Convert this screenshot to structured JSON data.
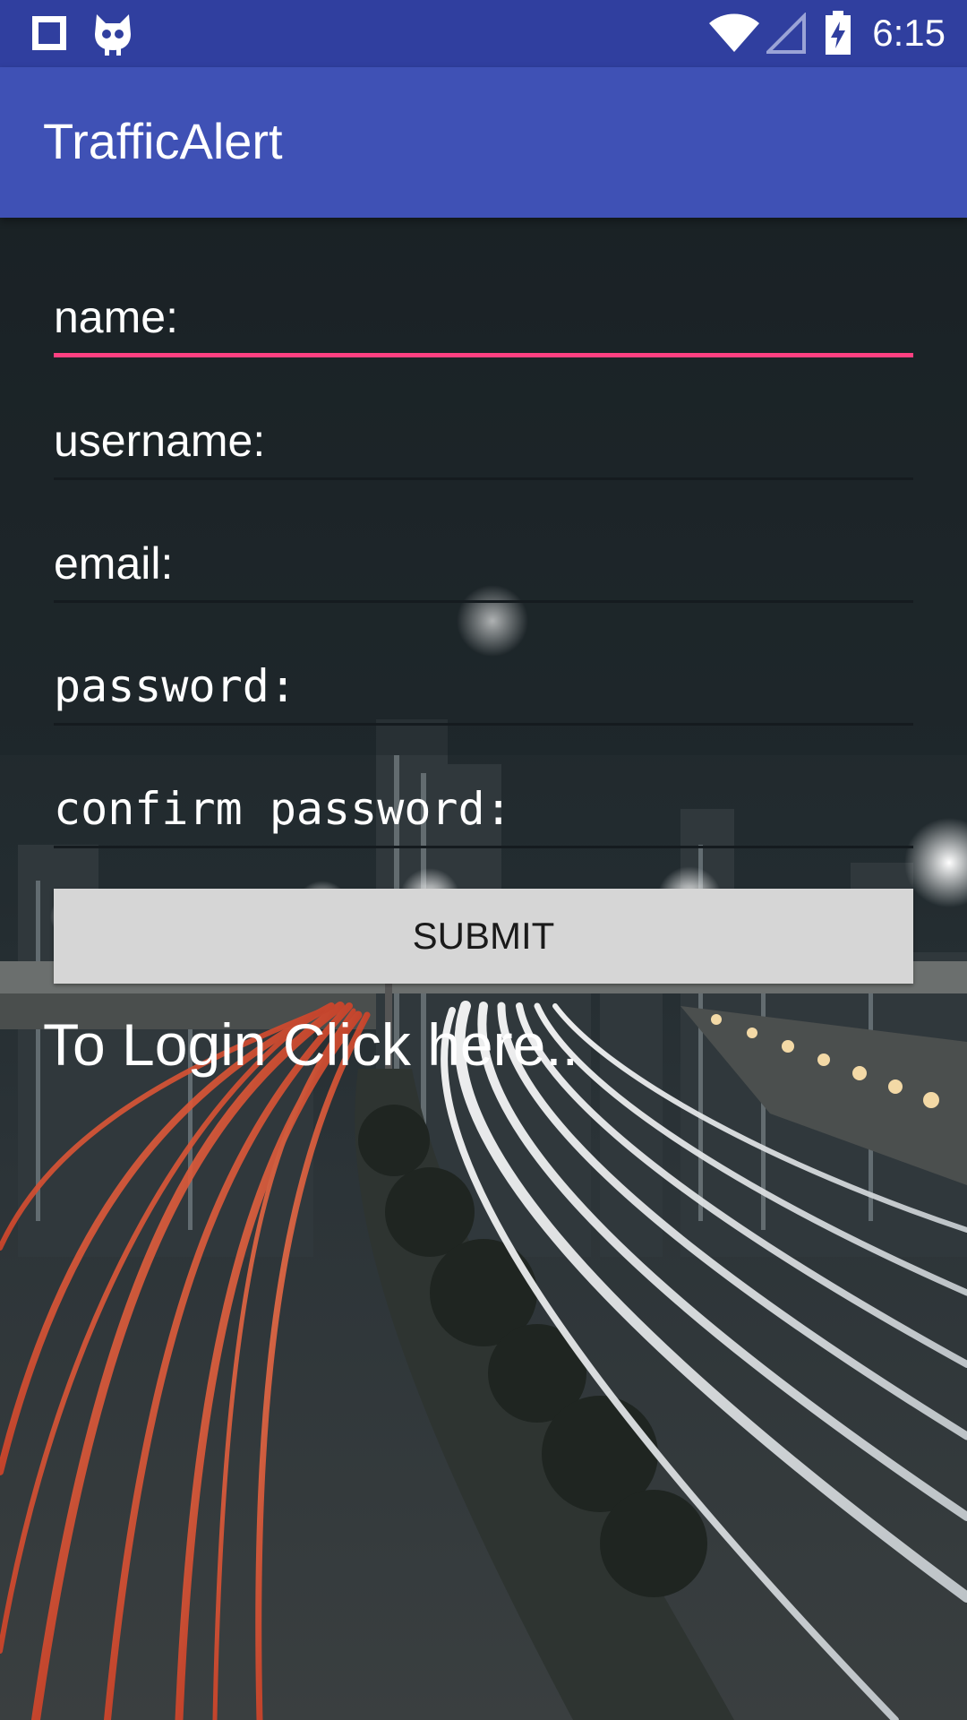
{
  "status_bar": {
    "time": "6:15",
    "icons": [
      "stop-square-icon",
      "cyanogen-cat-icon",
      "wifi-icon",
      "cell-signal-icon",
      "battery-charging-icon"
    ]
  },
  "app_bar": {
    "title": "TrafficAlert"
  },
  "form": {
    "name_placeholder": "name:",
    "username_placeholder": "username:",
    "email_placeholder": "email:",
    "password_placeholder": "password:",
    "confirm_password_placeholder": "confirm password:",
    "submit_label": "SUBMIT",
    "login_link": "To Login Click here.."
  },
  "colors": {
    "status_bar": "#303f9f",
    "app_bar": "#3f51b5",
    "focus_accent": "#ff4081",
    "button": "#d6d6d6"
  }
}
